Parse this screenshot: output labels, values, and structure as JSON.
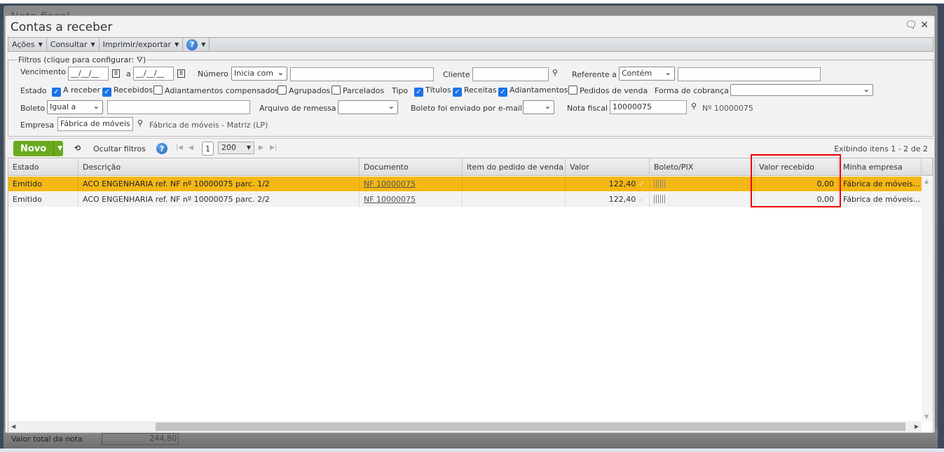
{
  "outer": {
    "title": "Nota fiscal",
    "total_label": "Valor total da nota",
    "total_value": "244,80"
  },
  "window": {
    "title": "Contas a receber"
  },
  "menu": {
    "acoes": "Ações",
    "consultar": "Consultar",
    "imprimir": "Imprimir/exportar"
  },
  "filters": {
    "legend": "Filtros (clique para configurar:",
    "legend_end": ")",
    "vencimento_label": "Vencimento",
    "date_from": "__/__/__",
    "date_sep": "a",
    "date_to": "__/__/__",
    "numero_label": "Número",
    "numero_op": "Inicia com",
    "numero_value": "",
    "cliente_label": "Cliente",
    "cliente_value": "",
    "referente_label": "Referente a",
    "referente_op": "Contém",
    "referente_value": "",
    "estado_label": "Estado",
    "estado_options": [
      {
        "label": "A receber",
        "checked": true
      },
      {
        "label": "Recebidos",
        "checked": true
      },
      {
        "label": "Adiantamentos compensados",
        "checked": false
      },
      {
        "label": "Agrupados",
        "checked": false
      },
      {
        "label": "Parcelados",
        "checked": false
      }
    ],
    "tipo_label": "Tipo",
    "tipo_options": [
      {
        "label": "Títulos",
        "checked": true
      },
      {
        "label": "Receitas",
        "checked": true
      },
      {
        "label": "Adiantamentos",
        "checked": true
      },
      {
        "label": "Pedidos de venda",
        "checked": false
      }
    ],
    "forma_label": "Forma de cobrança",
    "forma_value": "",
    "boleto_label": "Boleto",
    "boleto_op": "Igual a",
    "boleto_value": "",
    "arquivo_label": "Arquivo de remessa",
    "arquivo_value": "",
    "email_label": "Boleto foi enviado por e-mail",
    "email_value": "",
    "nota_label": "Nota fiscal",
    "nota_value": "10000075",
    "nota_desc": "Nº 10000075",
    "empresa_label": "Empresa",
    "empresa_value": "Fábrica de móveis -",
    "empresa_desc": "Fábrica de móveis - Matriz (LP)"
  },
  "toolbar": {
    "novo": "Novo",
    "ocultar": "Ocultar filtros",
    "page": "1",
    "page_size": "200",
    "status": "Exibindo itens 1 - 2 de 2"
  },
  "grid": {
    "columns": [
      "Estado",
      "Descrição",
      "Documento",
      "Item do pedido de venda",
      "Valor",
      "Boleto/PIX",
      "Valor recebido",
      "Minha empresa"
    ],
    "rows": [
      {
        "estado": "Emitido",
        "descricao": "ACO ENGENHARIA ref. NF nº 10000075 parc. 1/2",
        "documento": "NF 10000075",
        "item": "",
        "valor": "122,40",
        "valor_recebido": "0,00",
        "empresa": "Fábrica de móveis..."
      },
      {
        "estado": "Emitido",
        "descricao": "ACO ENGENHARIA ref. NF nº 10000075 parc. 2/2",
        "documento": "NF 10000075",
        "item": "",
        "valor": "122,40",
        "valor_recebido": "0,00",
        "empresa": "Fábrica de móveis..."
      }
    ]
  },
  "colors": {
    "selected_row": "#f4b715",
    "novo_button": "#6aaa1e",
    "highlight": "#e00000"
  }
}
